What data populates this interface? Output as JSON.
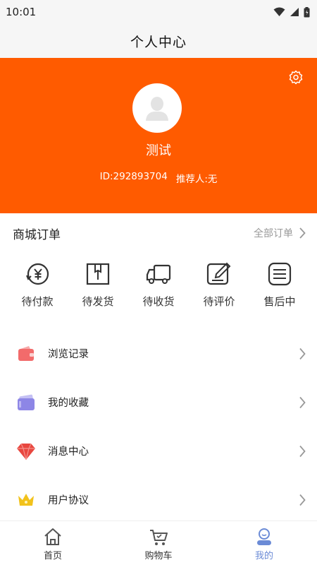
{
  "status": {
    "time": "10:01"
  },
  "header": {
    "title": "个人中心"
  },
  "profile": {
    "name": "测试",
    "id_text": "ID:292893704",
    "referrer_text": "推荐人:无"
  },
  "orders": {
    "title": "商城订单",
    "all_label": "全部订单",
    "items": [
      {
        "label": "待付款",
        "icon": "payment-icon"
      },
      {
        "label": "待发货",
        "icon": "box-icon"
      },
      {
        "label": "待收货",
        "icon": "truck-icon"
      },
      {
        "label": "待评价",
        "icon": "edit-icon"
      },
      {
        "label": "售后中",
        "icon": "document-icon"
      }
    ]
  },
  "menu": {
    "items": [
      {
        "label": "浏览记录",
        "icon": "wallet-icon",
        "color": "#f26b6b"
      },
      {
        "label": "我的收藏",
        "icon": "card-icon",
        "color": "#8d86e6"
      },
      {
        "label": "消息中心",
        "icon": "diamond-icon",
        "color": "#e8473f"
      },
      {
        "label": "用户协议",
        "icon": "crown-icon",
        "color": "#f2c21b"
      }
    ]
  },
  "tabs": [
    {
      "label": "首页",
      "icon": "home-icon"
    },
    {
      "label": "购物车",
      "icon": "cart-icon"
    },
    {
      "label": "我的",
      "icon": "profile-icon"
    }
  ],
  "colors": {
    "brand": "#ff5b00",
    "tab_active": "#6b8bd6"
  }
}
